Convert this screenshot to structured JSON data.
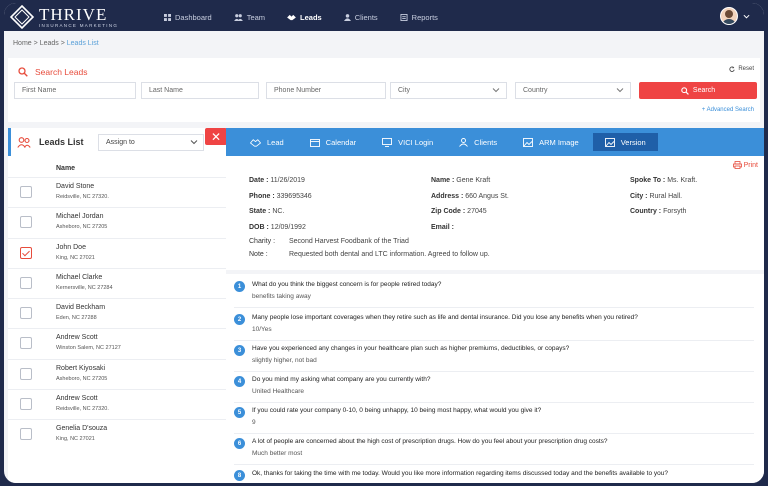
{
  "brand": {
    "name": "THRIVE",
    "tagline": "INSURANCE MARKETING"
  },
  "nav": [
    {
      "label": "Dashboard",
      "icon": "grid-icon"
    },
    {
      "label": "Team",
      "icon": "team-icon"
    },
    {
      "label": "Leads",
      "icon": "handshake-icon",
      "active": true
    },
    {
      "label": "Clients",
      "icon": "user-icon"
    },
    {
      "label": "Reports",
      "icon": "report-icon"
    }
  ],
  "breadcrumb": {
    "home": "Home",
    "sep": ">",
    "leads": "Leads",
    "current": "Leads List"
  },
  "search": {
    "title": "Search Leads",
    "reset": "Reset",
    "first_name": "First Name",
    "last_name": "Last Name",
    "phone": "Phone Number",
    "city": "City",
    "country": "Country",
    "button": "Search",
    "advanced": "Advanced Search"
  },
  "leads": {
    "title": "Leads List",
    "assign": "Assign to",
    "column": "Name",
    "close": "✕",
    "rows": [
      {
        "name": "David Stone",
        "addr": "Reidsville, NC 27320.",
        "checked": false
      },
      {
        "name": "Michael Jordan",
        "addr": "Asheboro, NC 27205",
        "checked": false
      },
      {
        "name": "John Doe",
        "addr": "King, NC 27021",
        "checked": true
      },
      {
        "name": "Michael Clarke",
        "addr": "Kernersville, NC 27284",
        "checked": false
      },
      {
        "name": "David Beckham",
        "addr": "Eden, NC 27288",
        "checked": false
      },
      {
        "name": "Andrew Scott",
        "addr": "Winston Salem, NC 27127",
        "checked": false
      },
      {
        "name": "Robert Kiyosaki",
        "addr": "Asheboro, NC 27205",
        "checked": false
      },
      {
        "name": "Andrew Scott",
        "addr": "Reidsville, NC 27320.",
        "checked": false
      },
      {
        "name": "Genelia D'souza",
        "addr": "King, NC 27021",
        "checked": false
      }
    ]
  },
  "tabs": [
    {
      "label": "Lead"
    },
    {
      "label": "Calendar"
    },
    {
      "label": "VICI Login"
    },
    {
      "label": "Clients"
    },
    {
      "label": "ARM Image"
    },
    {
      "label": "Version",
      "active": true
    }
  ],
  "print": "Print",
  "info": {
    "date_l": "Date :",
    "date": "11/26/2019",
    "phone_l": "Phone :",
    "phone": "339695346",
    "state_l": "State :",
    "state": "NC.",
    "dob_l": "DOB :",
    "dob": "12/09/1992",
    "name_l": "Name :",
    "name": "Gene Kraft",
    "address_l": "Address :",
    "address": "660 Angus St.",
    "zip_l": "Zip Code :",
    "zip": "27045",
    "email_l": "Email :",
    "email": "",
    "spoke_l": "Spoke To :",
    "spoke": "Ms. Kraft.",
    "city_l": "City :",
    "city": "Rural Hall.",
    "country_l": "Country :",
    "country": "Forsyth",
    "charity_l": "Charity :",
    "charity": "Second Harvest Foodbank of the Triad",
    "note_l": "Note :",
    "note": "Requested both dental and LTC information. Agreed to follow up."
  },
  "questions": [
    {
      "n": "1",
      "q": "What do you think the biggest concern is for people retired today?",
      "a": "benefits taking away"
    },
    {
      "n": "2",
      "q": "Many people lose important coverages when they retire such as life and dental insurance. Did you lose any benefits when you retired?",
      "a": "10/Yes"
    },
    {
      "n": "3",
      "q": "Have you experienced any changes in your healthcare plan such as higher premiums, deductibles, or copays?",
      "a": "slightly higher, not bad"
    },
    {
      "n": "4",
      "q": "Do you mind my asking what company are you currently with?",
      "a": "United Healthcare"
    },
    {
      "n": "5",
      "q": "If you could rate your company 0-10, 0 being unhappy, 10 being most happy, what would you give it?",
      "a": "9"
    },
    {
      "n": "6",
      "q": "A lot of people are concerned about the high cost of prescription drugs. How do you feel about your prescription drug costs?",
      "a": "Much better most"
    },
    {
      "n": "8",
      "q": "Ok, thanks for taking the time with me today. Would you like more information regarding items discussed today and the benefits available to you?",
      "a": ""
    }
  ],
  "colors": {
    "navy": "#1f2a4b",
    "accent": "#3b8fd9",
    "danger": "#ef4444"
  }
}
